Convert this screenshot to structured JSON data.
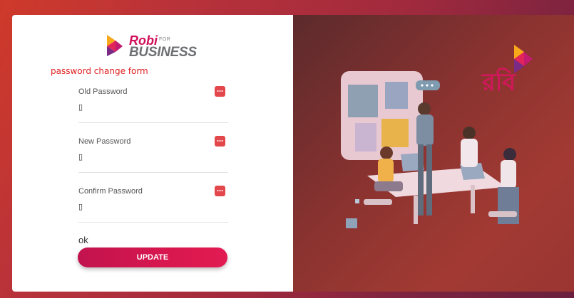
{
  "brand": {
    "logo_robi": "Robi",
    "logo_for": "FOR",
    "logo_business": "BUSINESS",
    "bengali_name": "রবি"
  },
  "form": {
    "caption": "password change form",
    "fields": [
      {
        "label": "Old Password",
        "value": "▯"
      },
      {
        "label": "New Password",
        "value": "▯"
      },
      {
        "label": "Confirm Password",
        "value": "▯"
      }
    ],
    "status_text": "ok",
    "submit_label": "UPDATE"
  },
  "colors": {
    "accent": "#d0105a",
    "key_icon": "#e2474b",
    "caption": "#e02020"
  },
  "icons": {
    "field_icon": "password-key-icon",
    "brand_mark": "robi-logo-mark"
  }
}
